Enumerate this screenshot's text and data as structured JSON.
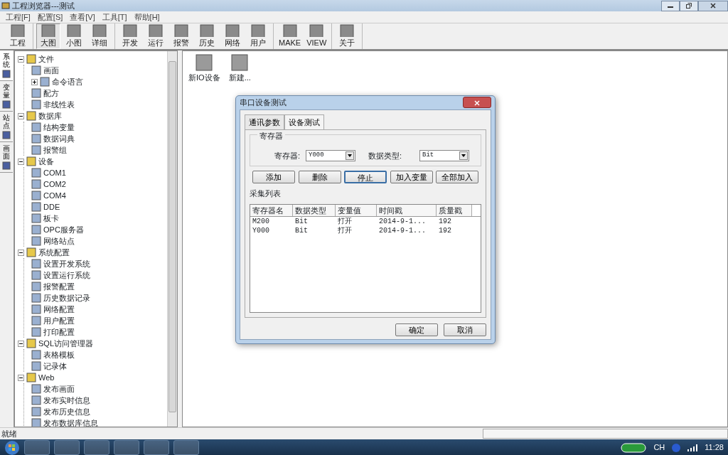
{
  "window": {
    "title": "工程浏览器---测试"
  },
  "menu": [
    "工程[F]",
    "配置[S]",
    "查看[V]",
    "工具[T]",
    "帮助[H]"
  ],
  "toolbar": [
    [
      {
        "label": "工程",
        "selected": false
      }
    ],
    [
      {
        "label": "大图",
        "selected": true
      },
      {
        "label": "小图",
        "selected": false
      },
      {
        "label": "详细",
        "selected": false
      }
    ],
    [
      {
        "label": "开发",
        "selected": false
      },
      {
        "label": "运行",
        "selected": false
      },
      {
        "label": "报警",
        "selected": false
      },
      {
        "label": "历史",
        "selected": false
      },
      {
        "label": "网络",
        "selected": false
      },
      {
        "label": "用户",
        "selected": false
      }
    ],
    [
      {
        "label": "MAKE",
        "selected": false
      },
      {
        "label": "VIEW",
        "selected": false
      }
    ],
    [
      {
        "label": "关于",
        "selected": false
      }
    ]
  ],
  "side_tabs": [
    {
      "label": "系统",
      "selected": true
    },
    {
      "label": "变量",
      "selected": false
    },
    {
      "label": "站点",
      "selected": false
    },
    {
      "label": "画面",
      "selected": false
    }
  ],
  "tree": [
    {
      "label": "文件",
      "expanded": true,
      "children": [
        {
          "label": "画面"
        },
        {
          "label": "命令语言",
          "expanded": false
        },
        {
          "label": "配方"
        },
        {
          "label": "非线性表"
        }
      ]
    },
    {
      "label": "数据库",
      "expanded": true,
      "children": [
        {
          "label": "结构变量"
        },
        {
          "label": "数据词典"
        },
        {
          "label": "报警组"
        }
      ]
    },
    {
      "label": "设备",
      "expanded": true,
      "children": [
        {
          "label": "COM1"
        },
        {
          "label": "COM2"
        },
        {
          "label": "COM4"
        },
        {
          "label": "DDE"
        },
        {
          "label": "板卡"
        },
        {
          "label": "OPC服务器"
        },
        {
          "label": "网络站点"
        }
      ]
    },
    {
      "label": "系统配置",
      "expanded": true,
      "children": [
        {
          "label": "设置开发系统"
        },
        {
          "label": "设置运行系统"
        },
        {
          "label": "报警配置"
        },
        {
          "label": "历史数据记录"
        },
        {
          "label": "网络配置"
        },
        {
          "label": "用户配置"
        },
        {
          "label": "打印配置"
        }
      ]
    },
    {
      "label": "SQL访问管理器",
      "expanded": true,
      "children": [
        {
          "label": "表格模板"
        },
        {
          "label": "记录体"
        }
      ]
    },
    {
      "label": "Web",
      "expanded": true,
      "children": [
        {
          "label": "发布画面"
        },
        {
          "label": "发布实时信息"
        },
        {
          "label": "发布历史信息"
        },
        {
          "label": "发布数据库信息"
        }
      ]
    }
  ],
  "content_items": [
    "新IO设备",
    "新建..."
  ],
  "dialog": {
    "title": "串口设备测试",
    "tabs": [
      {
        "label": "通讯参数",
        "selected": false
      },
      {
        "label": "设备测试",
        "selected": true
      }
    ],
    "group_title": "寄存器",
    "register_label": "寄存器:",
    "register_value": "Y000",
    "type_label": "数据类型:",
    "type_value": "Bit",
    "buttons": [
      {
        "label": "添加",
        "default": false
      },
      {
        "label": "删除",
        "default": false
      },
      {
        "label": "停止",
        "default": true
      },
      {
        "label": "加入变量",
        "default": false
      },
      {
        "label": "全部加入",
        "default": false
      }
    ],
    "list_label": "采集列表",
    "columns": [
      "寄存器名",
      "数据类型",
      "变量值",
      "时间戳",
      "质量戳"
    ],
    "rows": [
      [
        "M200",
        "Bit",
        "打开",
        "2014-9-1...",
        "192"
      ],
      [
        "Y000",
        "Bit",
        "打开",
        "2014-9-1...",
        "192"
      ]
    ],
    "footer_buttons": [
      "确定",
      "取消"
    ]
  },
  "status_bar": {
    "text": "就绪"
  },
  "taskbar": {
    "language": "CH",
    "clock": "11:28"
  }
}
